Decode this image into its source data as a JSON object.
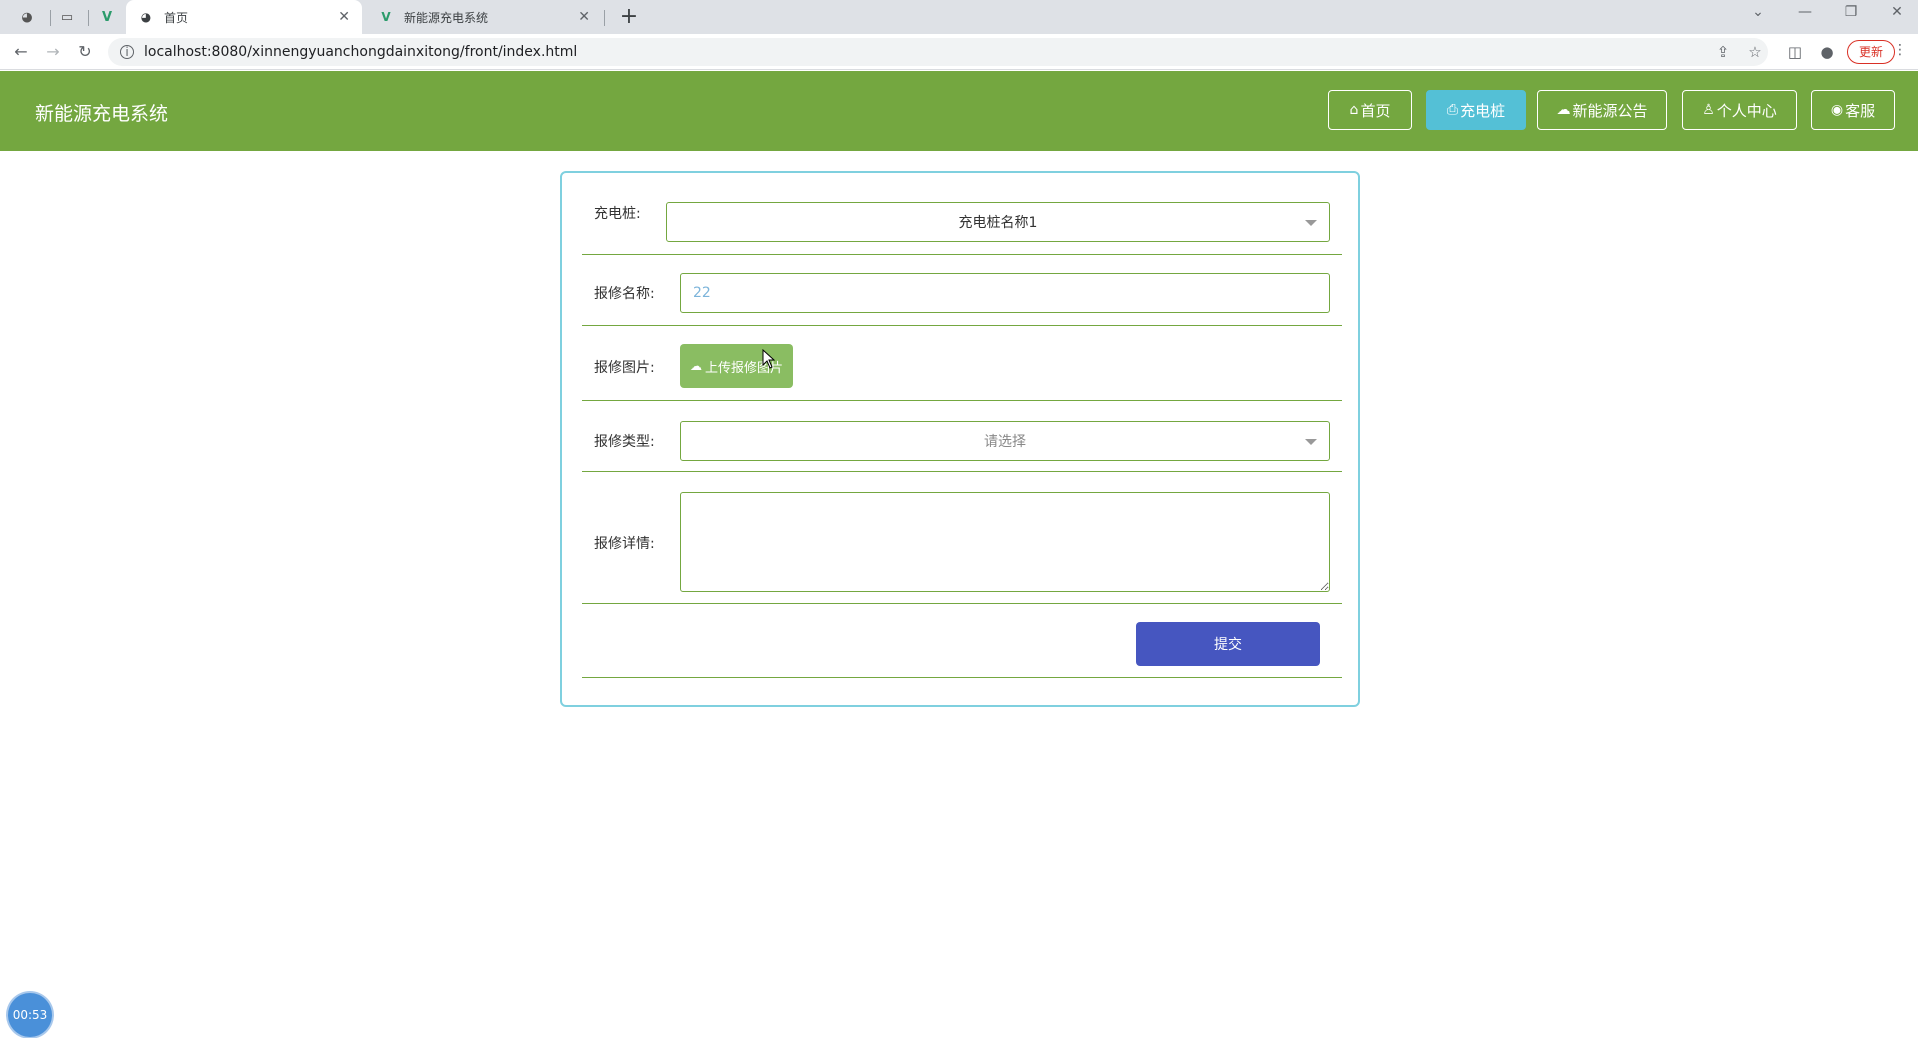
{
  "browser": {
    "tabs": [
      {
        "title": "首页",
        "active": true
      },
      {
        "title": "新能源充电系统",
        "active": false
      }
    ],
    "url": "localhost:8080/xinnengyuanchongdainxitong/front/index.html",
    "update_label": "更新"
  },
  "header": {
    "title": "新能源充电系统",
    "nav": [
      {
        "label": "首页",
        "icon": "home-icon"
      },
      {
        "label": "充电桩",
        "icon": "printer-icon"
      },
      {
        "label": "新能源公告",
        "icon": "cloud-icon"
      },
      {
        "label": "个人中心",
        "icon": "user-icon"
      },
      {
        "label": "客服",
        "icon": "chat-icon"
      }
    ],
    "colors": {
      "header_bg": "#74a740",
      "active_nav": "#54c0d6"
    }
  },
  "form": {
    "station_label": "充电桩:",
    "station_value": "充电桩名称1",
    "name_label": "报修名称:",
    "name_value": "22",
    "image_label": "报修图片:",
    "upload_label": "上传报修图片",
    "type_label": "报修类型:",
    "type_placeholder": "请选择",
    "detail_label": "报修详情:",
    "detail_value": "",
    "submit_label": "提交"
  },
  "timer": "00:53"
}
